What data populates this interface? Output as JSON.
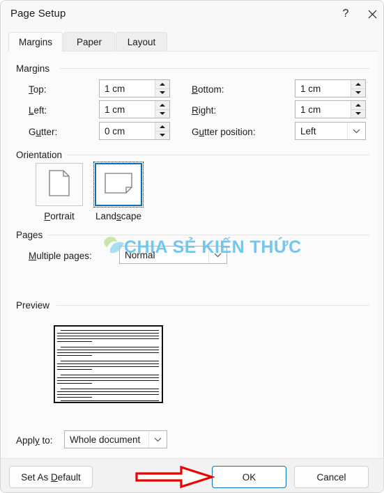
{
  "window": {
    "title": "Page Setup",
    "help_icon": "question-mark-icon",
    "close_icon": "close-icon"
  },
  "tabs": [
    {
      "label": "Margins",
      "active": true
    },
    {
      "label": "Paper",
      "active": false
    },
    {
      "label": "Layout",
      "active": false
    }
  ],
  "groups": {
    "margins": "Margins",
    "orientation": "Orientation",
    "pages": "Pages",
    "preview": "Preview"
  },
  "margins": {
    "top": {
      "label": "Top:",
      "value": "1 cm"
    },
    "left": {
      "label": "Left:",
      "value": "1 cm"
    },
    "gutter": {
      "label": "Gutter:",
      "value": "0 cm"
    },
    "bottom": {
      "label": "Bottom:",
      "value": "1 cm"
    },
    "right": {
      "label": "Right:",
      "value": "1 cm"
    },
    "gutter_position": {
      "label": "Gutter position:",
      "value": "Left"
    }
  },
  "orientation": {
    "portrait": {
      "label": "Portrait",
      "selected": false,
      "icon": "portrait-page-icon"
    },
    "landscape": {
      "label": "Landscape",
      "selected": true,
      "icon": "landscape-page-icon"
    }
  },
  "pages": {
    "multiple_pages": {
      "label": "Multiple pages:",
      "value": "Normal"
    }
  },
  "apply_to": {
    "label": "Apply to:",
    "value": "Whole document"
  },
  "buttons": {
    "set_as_default": "Set As Default",
    "ok": "OK",
    "cancel": "Cancel"
  },
  "annotation": {
    "arrow": "red-arrow-pointing-to-ok",
    "color": "#ee0000"
  },
  "watermark": {
    "text": "CHIA SẺ KIẾN THỨC",
    "color": "#6cc4ef"
  },
  "colors": {
    "accent": "#0b6ebd",
    "dialog_bg": "#f8f8f8",
    "panel_bg": "#fbfbfb",
    "footer_bg": "#f2f2f2",
    "text": "#1b1b1b"
  }
}
